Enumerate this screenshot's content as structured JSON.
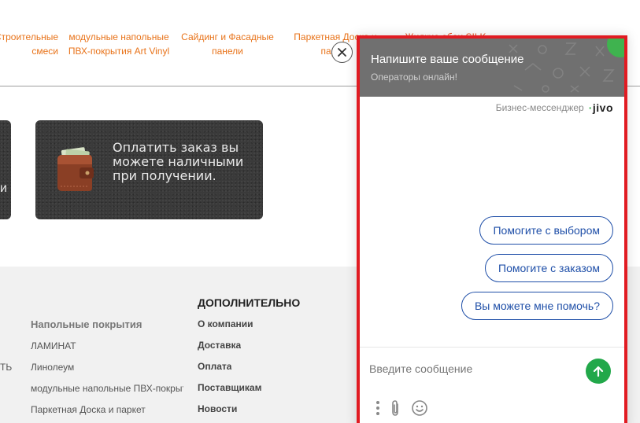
{
  "top_menu": {
    "items": [
      {
        "line1": "Строительные",
        "line2": "смеси"
      },
      {
        "line1": "модульные напольные",
        "line2": "ПВХ-покрытия Art Vinyl"
      },
      {
        "line1": "Сайдинг и Фасадные",
        "line2": "панели"
      },
      {
        "line1": "Паркетная Доска и",
        "line2": "паркет"
      },
      {
        "line1": "Жидкие обои SILK",
        "line2": ""
      }
    ]
  },
  "banners": {
    "left_fragment": "и",
    "cash_payment": "Оплатить заказ вы можете наличными при получении."
  },
  "footer": {
    "left_fragment": "ТЬ",
    "floor": {
      "heading": "Напольные покрытия",
      "links": [
        "ЛАМИНАТ",
        "Линолеум",
        "модульные напольные ПВХ-покрытия",
        "Паркетная Доска и паркет"
      ]
    },
    "extra": {
      "heading": "ДОПОЛНИТЕЛЬНО",
      "links": [
        "О компании",
        "Доставка",
        "Оплата",
        "Поставщикам",
        "Новости"
      ]
    }
  },
  "chat": {
    "title": "Напишите ваше сообщение",
    "subtitle": "Операторы онлайн!",
    "brand_label": "Бизнес-мессенджер",
    "brand_name": "jivo",
    "suggestions": [
      "Помогите с выбором",
      "Помогите с заказом",
      "Вы можете мне помочь?"
    ],
    "input_placeholder": "Введите сообщение",
    "colors": {
      "accent_border": "#e11b22",
      "send": "#22a84a",
      "online": "#3fb34f",
      "suggestion": "#1f4fa8"
    }
  },
  "icons": [
    "close-icon",
    "wallet-icon",
    "send-arrow-icon",
    "more-vertical-icon",
    "paperclip-icon",
    "emoji-icon"
  ]
}
